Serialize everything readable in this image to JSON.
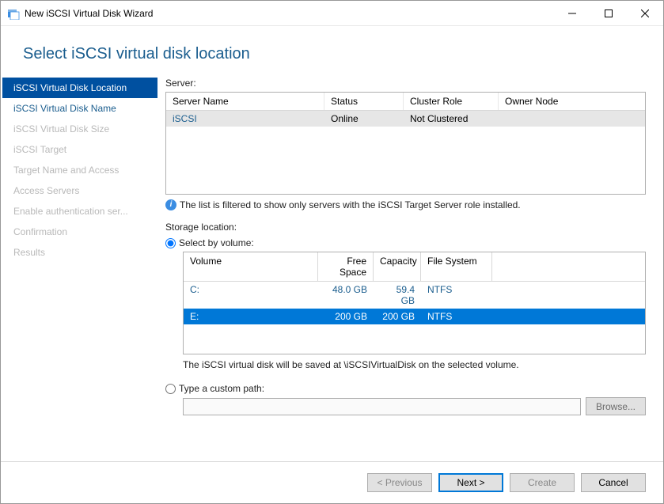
{
  "window": {
    "title": "New iSCSI Virtual Disk Wizard"
  },
  "heading": "Select iSCSI virtual disk location",
  "steps": [
    {
      "label": "iSCSI Virtual Disk Location",
      "state": "active"
    },
    {
      "label": "iSCSI Virtual Disk Name",
      "state": "enabled"
    },
    {
      "label": "iSCSI Virtual Disk Size",
      "state": "disabled"
    },
    {
      "label": "iSCSI Target",
      "state": "disabled"
    },
    {
      "label": "Target Name and Access",
      "state": "disabled"
    },
    {
      "label": "Access Servers",
      "state": "disabled"
    },
    {
      "label": "Enable authentication ser...",
      "state": "disabled"
    },
    {
      "label": "Confirmation",
      "state": "disabled"
    },
    {
      "label": "Results",
      "state": "disabled"
    }
  ],
  "server_section": {
    "label": "Server:",
    "columns": {
      "name": "Server Name",
      "status": "Status",
      "cluster": "Cluster Role",
      "owner": "Owner Node"
    },
    "rows": [
      {
        "name": "iSCSI",
        "status": "Online",
        "cluster": "Not Clustered",
        "owner": ""
      }
    ],
    "info": "The list is filtered to show only servers with the iSCSI Target Server role installed."
  },
  "storage_section": {
    "label": "Storage location:",
    "radio_volume_label": "Select by volume:",
    "radio_path_label": "Type a custom path:",
    "selected_radio": "volume",
    "columns": {
      "volume": "Volume",
      "free": "Free Space",
      "capacity": "Capacity",
      "fs": "File System"
    },
    "volumes": [
      {
        "volume": "C:",
        "free": "48.0 GB",
        "capacity": "59.4 GB",
        "fs": "NTFS",
        "selected": false
      },
      {
        "volume": "E:",
        "free": "200 GB",
        "capacity": "200 GB",
        "fs": "NTFS",
        "selected": true
      }
    ],
    "hint": "The iSCSI virtual disk will be saved at \\iSCSIVirtualDisk on the selected volume.",
    "custom_path_value": "",
    "browse_label": "Browse..."
  },
  "footer": {
    "previous": "< Previous",
    "next": "Next >",
    "create": "Create",
    "cancel": "Cancel"
  }
}
